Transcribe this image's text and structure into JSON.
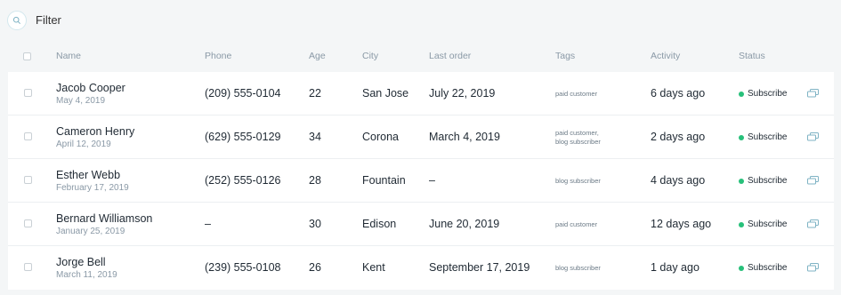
{
  "filter": {
    "label": "Filter",
    "icon": "search-icon"
  },
  "columns": [
    "Name",
    "Phone",
    "Age",
    "City",
    "Last order",
    "Tags",
    "Activity",
    "Status"
  ],
  "status_color": "#27c07a",
  "rows": [
    {
      "name": "Jacob Cooper",
      "date": "May 4, 2019",
      "phone": "(209) 555-0104",
      "age": "22",
      "city": "San Jose",
      "last_order": "July 22, 2019",
      "tags": [
        "paid customer"
      ],
      "activity": "6 days ago",
      "status": "Subscribe"
    },
    {
      "name": "Cameron Henry",
      "date": "April 12, 2019",
      "phone": "(629) 555-0129",
      "age": "34",
      "city": "Corona",
      "last_order": "March 4, 2019",
      "tags": [
        "paid customer,",
        "blog subscriber"
      ],
      "activity": "2 days ago",
      "status": "Subscribe"
    },
    {
      "name": "Esther Webb",
      "date": "February 17, 2019",
      "phone": "(252) 555-0126",
      "age": "28",
      "city": "Fountain",
      "last_order": "–",
      "tags": [
        "blog subscriber"
      ],
      "activity": "4 days ago",
      "status": "Subscribe"
    },
    {
      "name": "Bernard Williamson",
      "date": "January 25, 2019",
      "phone": "–",
      "age": "30",
      "city": "Edison",
      "last_order": "June 20, 2019",
      "tags": [
        "paid customer"
      ],
      "activity": "12 days ago",
      "status": "Subscribe"
    },
    {
      "name": "Jorge Bell",
      "date": "March 11, 2019",
      "phone": "(239) 555-0108",
      "age": "26",
      "city": "Kent",
      "last_order": "September 17, 2019",
      "tags": [
        "blog subscriber"
      ],
      "activity": "1 day ago",
      "status": "Subscribe"
    }
  ]
}
